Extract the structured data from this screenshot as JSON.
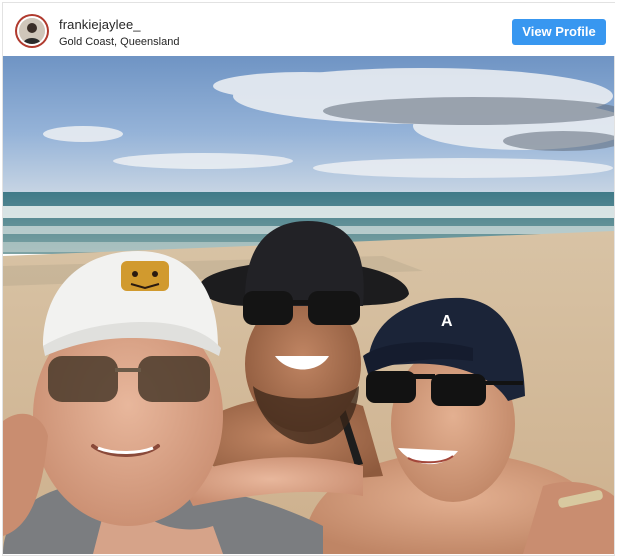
{
  "post": {
    "username": "frankiejaylee_",
    "location": "Gold Coast, Queensland",
    "view_profile_label": "View Profile",
    "profile_avatar_icon": "avatar-icon",
    "photo_description_icon": "beach-selfie-photo"
  },
  "colors": {
    "button_blue": "#3897f0",
    "text_dark": "#262626",
    "avatar_ring": "#b03a2e"
  }
}
